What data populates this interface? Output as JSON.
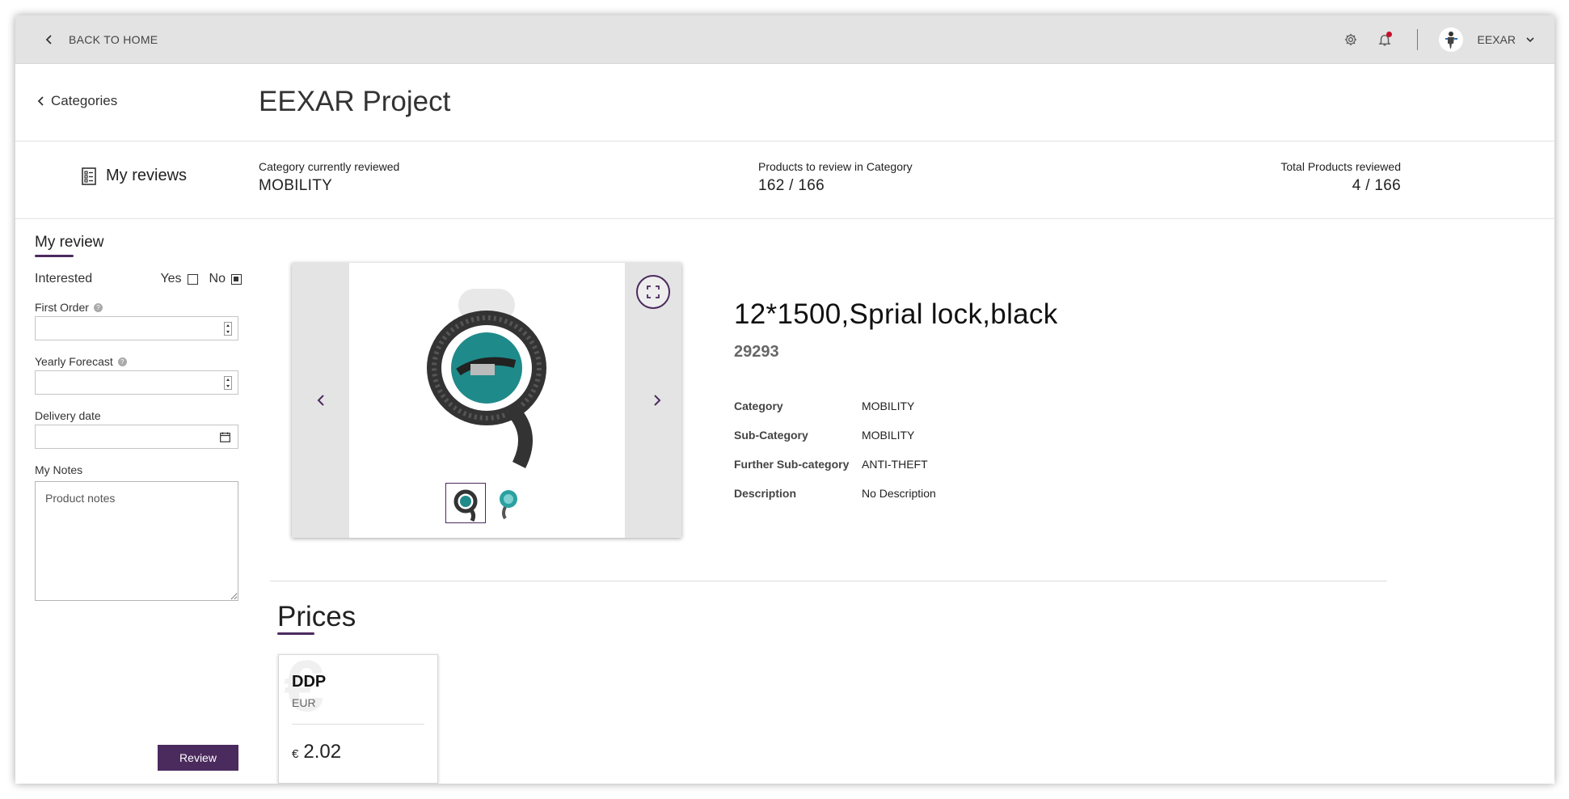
{
  "topbar": {
    "back_label": "BACK TO HOME",
    "user_name": "EEXAR",
    "icons": [
      "gear-icon",
      "bell-icon",
      "chevron-down-icon"
    ]
  },
  "header": {
    "back_label": "Categories",
    "project_title": "EEXAR Project"
  },
  "stats": {
    "my_reviews_label": "My reviews",
    "category_label": "Category currently reviewed",
    "category_value": "MOBILITY",
    "to_review_label": "Products to review in Category",
    "to_review_value": "162 / 166",
    "total_label": "Total Products reviewed",
    "total_value": "4 / 166"
  },
  "review": {
    "title": "My review",
    "interested_label": "Interested",
    "yes_label": "Yes",
    "no_label": "No",
    "yes_checked": false,
    "no_checked": true,
    "first_order_label": "First Order",
    "first_order_value": "",
    "yearly_forecast_label": "Yearly Forecast",
    "yearly_forecast_value": "",
    "delivery_date_label": "Delivery date",
    "delivery_date_value": "",
    "notes_label": "My Notes",
    "notes_placeholder": "Product notes",
    "review_button": "Review"
  },
  "product": {
    "name": "12*1500,Sprial lock,black",
    "code": "29293",
    "details": [
      {
        "key": "Category",
        "value": "MOBILITY"
      },
      {
        "key": "Sub-Category",
        "value": "MOBILITY"
      },
      {
        "key": "Further Sub-category",
        "value": "ANTI-THEFT"
      },
      {
        "key": "Description",
        "value": "No Description"
      }
    ]
  },
  "prices": {
    "title": "Prices",
    "cards": [
      {
        "title": "DDP",
        "currency": "EUR",
        "symbol": "€",
        "amount": "2.02"
      }
    ]
  },
  "colors": {
    "accent": "#4b2a5e",
    "topbar_bg": "#e3e3e3",
    "notification": "#c8102e"
  }
}
